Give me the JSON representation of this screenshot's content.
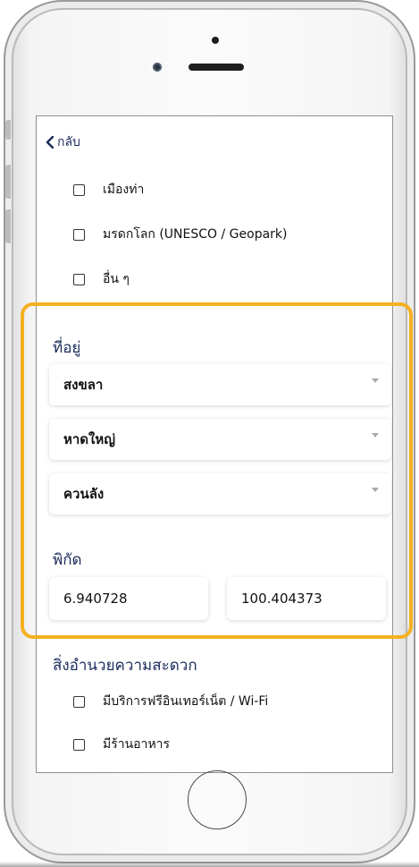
{
  "nav": {
    "back_label": "กลับ"
  },
  "categories": [
    {
      "label": "เมืองท่า",
      "checked": false
    },
    {
      "label": "มรดกโลก (UNESCO / Geopark)",
      "checked": false
    },
    {
      "label": "อื่น ๆ",
      "checked": false
    }
  ],
  "address": {
    "title": "ที่อยู่",
    "province": "สงขลา",
    "district": "หาดใหญ่",
    "subdistrict": "ควนลัง"
  },
  "coordinates": {
    "title": "พิกัด",
    "latitude": "6.940728",
    "longitude": "100.404373"
  },
  "facilities": {
    "title": "สิ่งอำนวยความสะดวก",
    "items": [
      {
        "label": "มีบริการฟรีอินเทอร์เน็ต / Wi-Fi",
        "checked": false
      },
      {
        "label": "มีร้านอาหาร",
        "checked": false
      }
    ]
  },
  "colors": {
    "highlight": "#f5b021",
    "heading": "#1c2c5b"
  }
}
